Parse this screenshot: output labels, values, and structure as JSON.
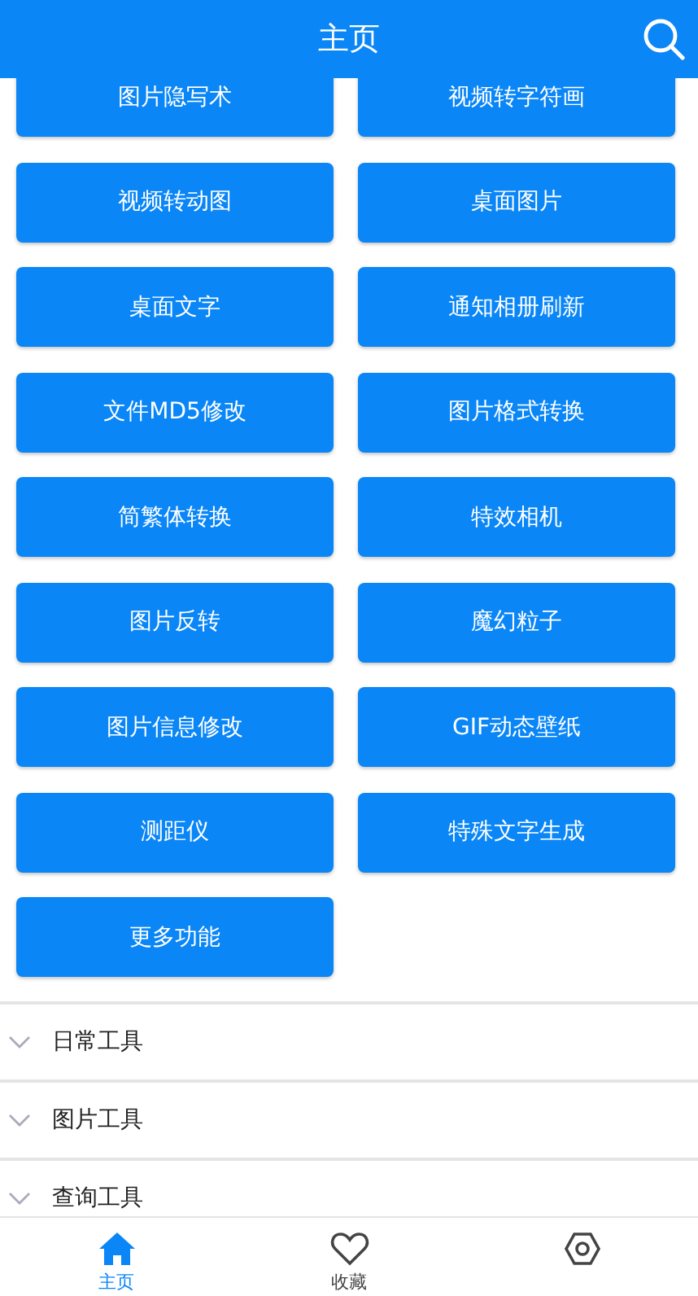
{
  "header": {
    "title": "主页"
  },
  "tools": [
    "图片隐写术",
    "视频转字符画",
    "视频转动图",
    "桌面图片",
    "桌面文字",
    "通知相册刷新",
    "文件MD5修改",
    "图片格式转换",
    "简繁体转换",
    "特效相机",
    "图片反转",
    "魔幻粒子",
    "图片信息修改",
    "GIF动态壁纸",
    "测距仪",
    "特殊文字生成",
    "更多功能"
  ],
  "sections": [
    {
      "title": "日常工具"
    },
    {
      "title": "图片工具"
    },
    {
      "title": "查询工具"
    }
  ],
  "nav": [
    {
      "kind": "home",
      "label": "主页",
      "selected": true
    },
    {
      "kind": "heart",
      "label": "收藏",
      "selected": false
    },
    {
      "kind": "gear",
      "selected": false
    }
  ]
}
